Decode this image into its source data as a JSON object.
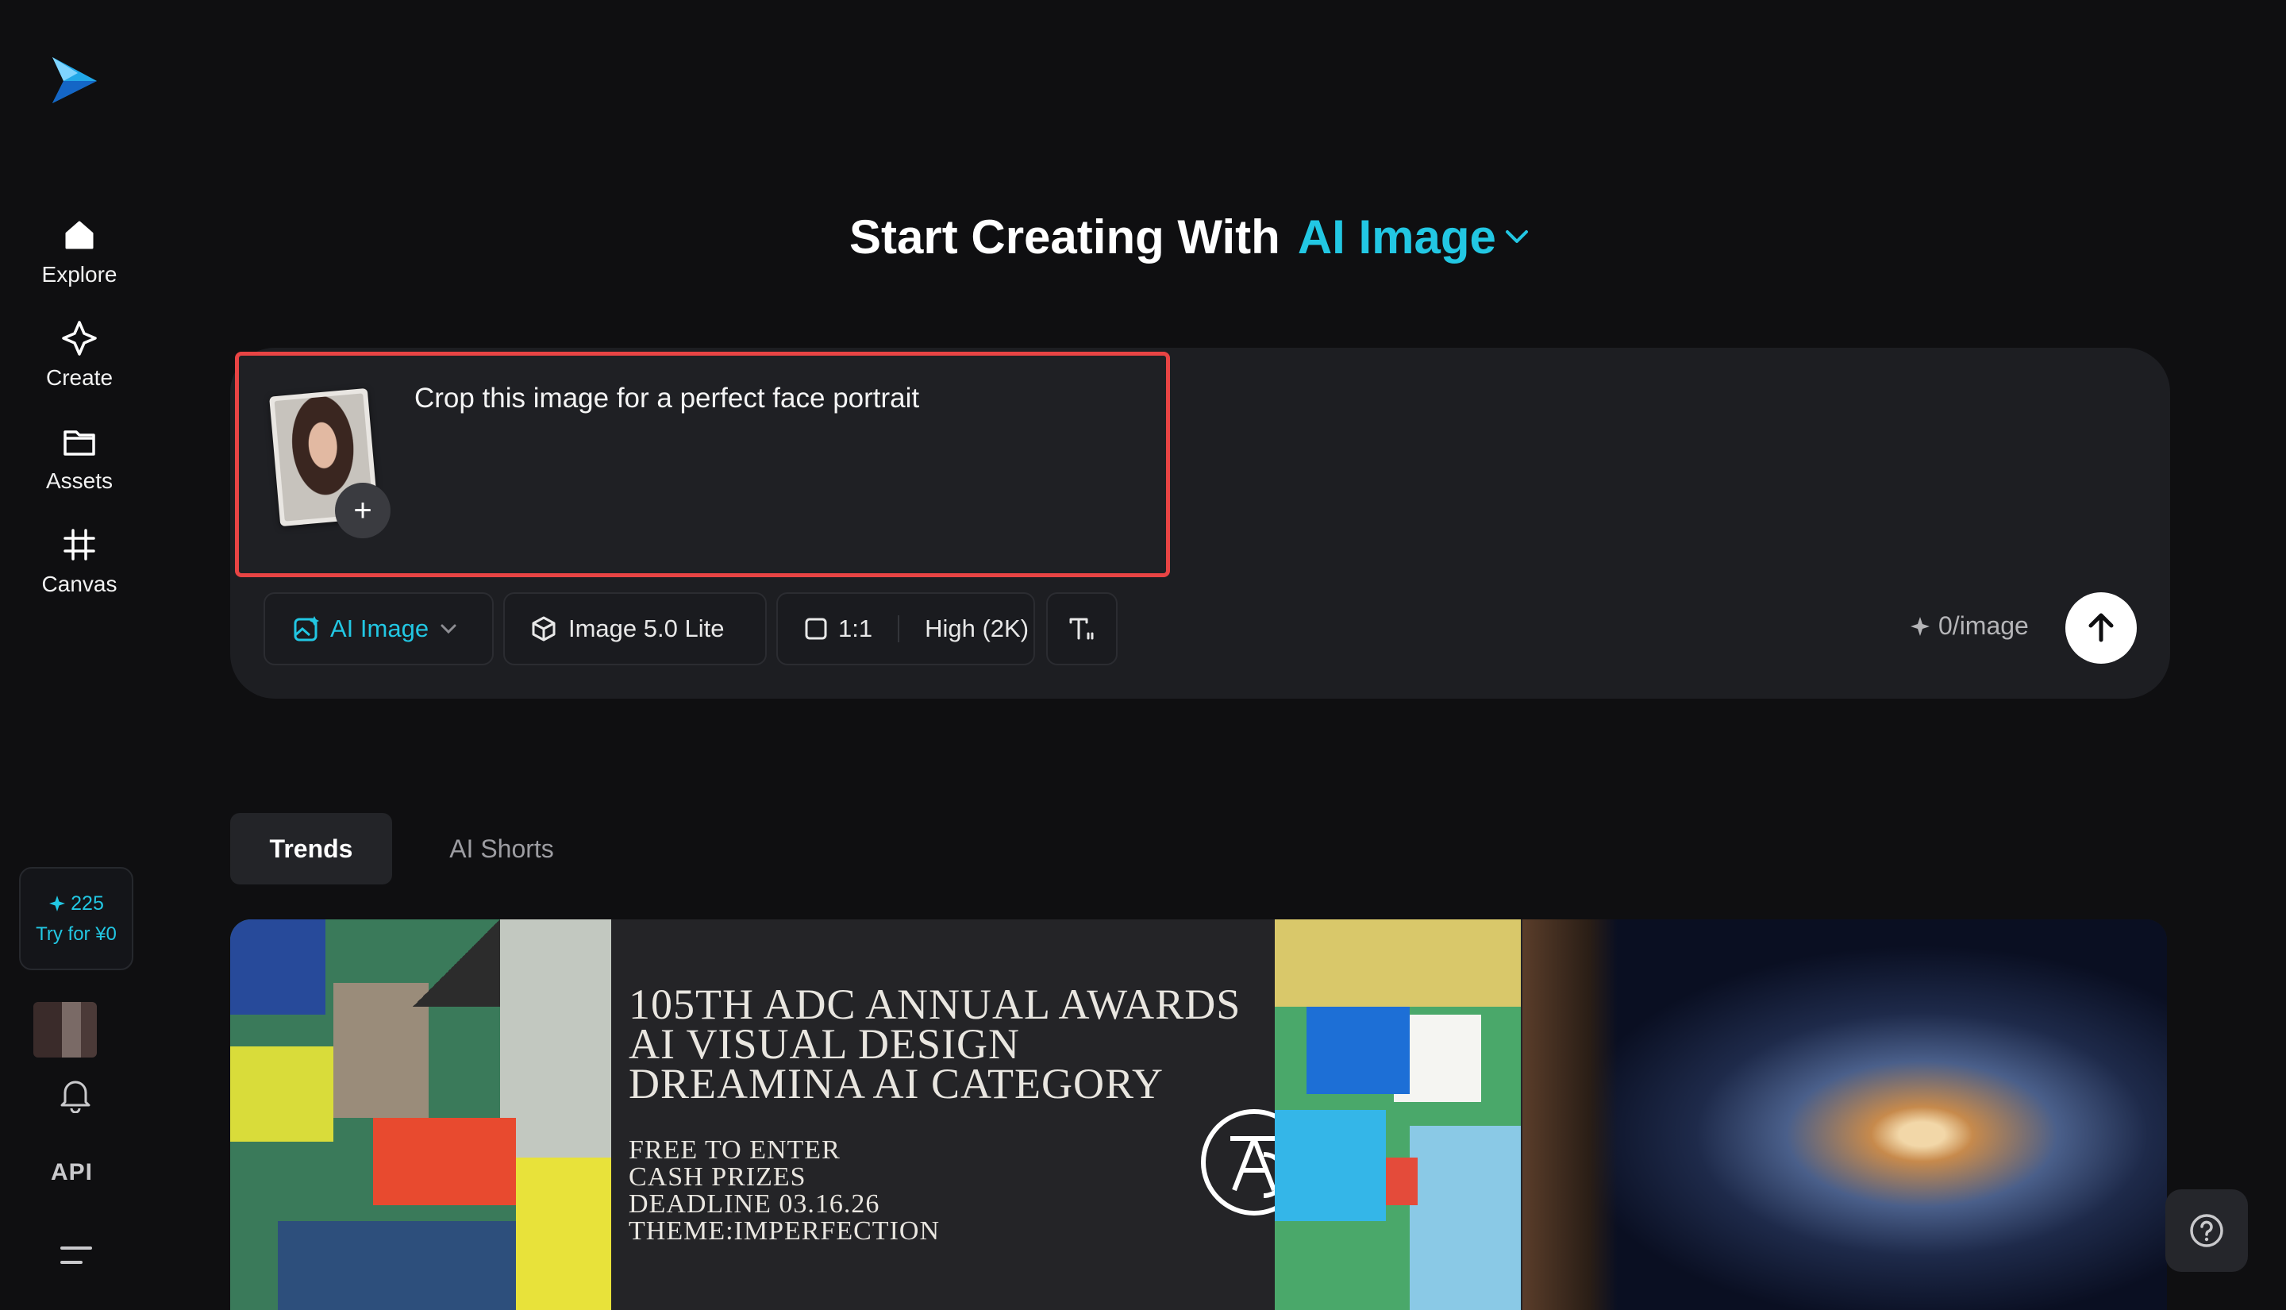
{
  "sidebar": {
    "items": [
      {
        "label": "Explore",
        "icon": "home-icon"
      },
      {
        "label": "Create",
        "icon": "sparkle-icon"
      },
      {
        "label": "Assets",
        "icon": "folder-icon"
      },
      {
        "label": "Canvas",
        "icon": "crop-grid-icon"
      }
    ],
    "credits": {
      "count": "225",
      "try_label": "Try for ¥0"
    },
    "api_label": "API"
  },
  "heading": {
    "prefix": "Start Creating With",
    "accent": "AI Image"
  },
  "prompt": {
    "value": "Crop this image for a perfect face portrait"
  },
  "toolbar": {
    "mode_label": "AI Image",
    "model_label": "Image 5.0 Lite",
    "ratio_label": "1:1",
    "quality_label": "High (2K)",
    "cost_label": "0/image"
  },
  "tabs": [
    {
      "label": "Trends",
      "active": true
    },
    {
      "label": "AI Shorts",
      "active": false
    }
  ],
  "banner": {
    "title_lines": [
      "105TH ADC ANNUAL AWARDS",
      "AI VISUAL DESIGN",
      "DREAMINA AI CATEGORY"
    ],
    "sub_lines": [
      "FREE TO ENTER",
      "CASH PRIZES",
      "DEADLINE 03.16.26",
      "THEME:IMPERFECTION"
    ]
  },
  "colors": {
    "accent": "#22c7e3",
    "background": "#0f0f11",
    "card": "#1d1e22",
    "highlight": "#e84444"
  }
}
